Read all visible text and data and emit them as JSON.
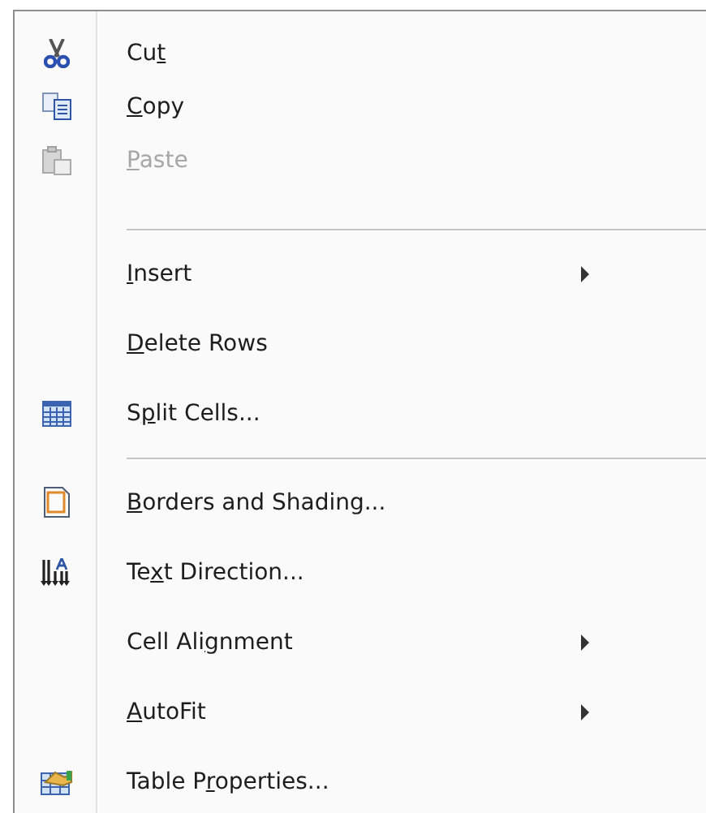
{
  "menu": {
    "items": [
      {
        "kind": "item",
        "before": "Cu",
        "key": "t",
        "disabled": false,
        "submenu": false
      },
      {
        "kind": "item",
        "key": "C",
        "after": "opy",
        "disabled": false,
        "submenu": false
      },
      {
        "kind": "item",
        "key": "P",
        "after": "aste",
        "disabled": true,
        "submenu": false
      },
      {
        "kind": "separator"
      },
      {
        "kind": "item",
        "key": "I",
        "after": "nsert",
        "disabled": false,
        "submenu": true
      },
      {
        "kind": "item",
        "key": "D",
        "after": "elete Rows",
        "disabled": false,
        "submenu": false
      },
      {
        "kind": "item",
        "before": "S",
        "key": "p",
        "after": "lit Cells...",
        "disabled": false,
        "submenu": false
      },
      {
        "kind": "separator"
      },
      {
        "kind": "item",
        "key": "B",
        "after": "orders and Shading...",
        "disabled": false,
        "submenu": false
      },
      {
        "kind": "item",
        "before": "Te",
        "key": "x",
        "after": "t Direction...",
        "disabled": false,
        "submenu": false
      },
      {
        "kind": "item",
        "before": "Cell Ali",
        "key": "g",
        "after": "nment",
        "disabled": false,
        "submenu": true
      },
      {
        "kind": "item",
        "key": "A",
        "after": "utoFit",
        "disabled": false,
        "submenu": true
      },
      {
        "kind": "item",
        "before": "Table P",
        "key": "r",
        "after": "operties...",
        "disabled": false,
        "submenu": false
      }
    ]
  }
}
